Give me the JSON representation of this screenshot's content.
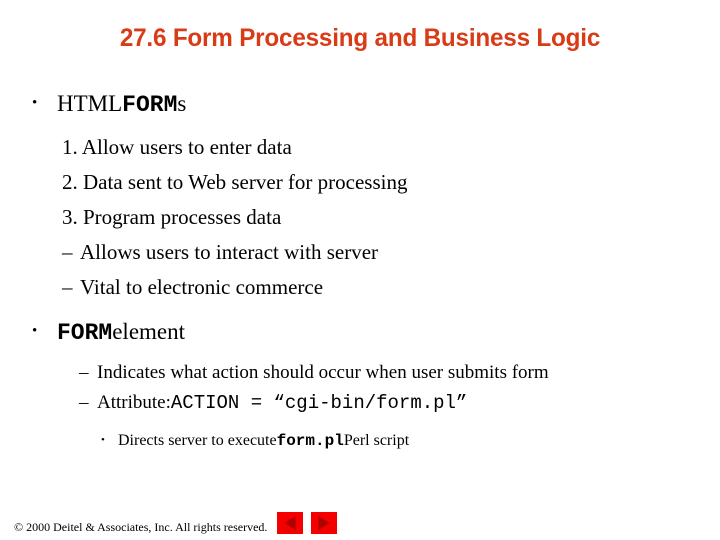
{
  "slide": {
    "title": "27.6 Form Processing and Business Logic",
    "title_color": "#d93b17"
  },
  "bullets": {
    "b1": {
      "marker": "•",
      "text_a": "HTML ",
      "code_b": "FORM",
      "text_c": "s"
    },
    "n1": {
      "marker": "",
      "text": "1. Allow users to enter data"
    },
    "n2": {
      "marker": "",
      "text": "2. Data sent to Web server for processing"
    },
    "n3": {
      "marker": "",
      "text": "3. Program processes data"
    },
    "d1": {
      "marker": "–",
      "text": "Allows users to interact with server"
    },
    "d2": {
      "marker": "–",
      "text": "Vital to electronic commerce"
    },
    "b2": {
      "marker": "•",
      "code_a": "FORM",
      "text_b": " element"
    },
    "d3": {
      "marker": "–",
      "text": "Indicates what action should occur when user submits form"
    },
    "d4": {
      "marker": "–",
      "text_a": "Attribute: ",
      "code_b": "ACTION = “cgi-bin/form.pl”"
    },
    "d5": {
      "marker": "•",
      "text_a": "Directs server to execute ",
      "code_b": "form.pl",
      "text_c": " Perl script"
    }
  },
  "footer": {
    "copyright": "© 2000 Deitel & Associates, Inc.  All rights reserved.",
    "prev_label": "Previous slide",
    "next_label": "Next slide",
    "button_color": "#f40000"
  }
}
